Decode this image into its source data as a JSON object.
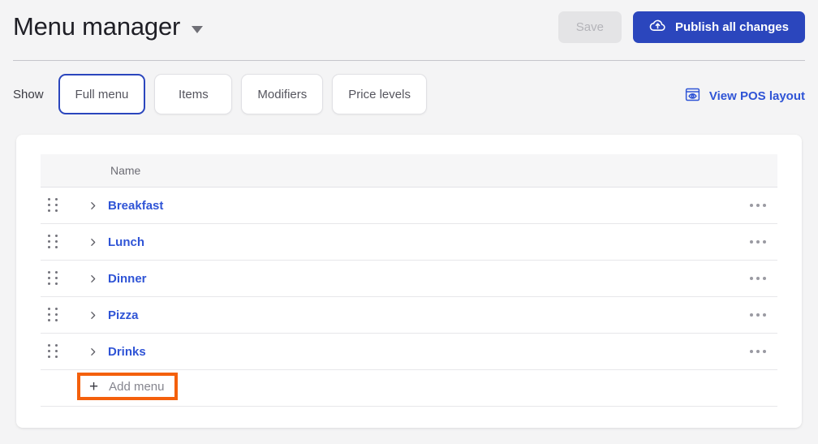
{
  "header": {
    "title": "Menu manager",
    "title_caret_icon": "chevron-down-icon",
    "save_label": "Save",
    "publish_label": "Publish all changes",
    "publish_icon": "cloud-upload-icon",
    "accent_blue": "#2b46bd"
  },
  "filter_bar": {
    "show_label": "Show",
    "tabs": [
      {
        "label": "Full menu",
        "selected": true
      },
      {
        "label": "Items",
        "selected": false
      },
      {
        "label": "Modifiers",
        "selected": false
      },
      {
        "label": "Price levels",
        "selected": false
      }
    ],
    "pos_link_label": "View POS layout",
    "pos_link_icon": "eye-window-icon",
    "link_color": "#2f54d6"
  },
  "table": {
    "columns": [
      "Name"
    ],
    "rows": [
      {
        "name": "Breakfast",
        "drag_icon": "drag-handle-icon",
        "expand_icon": "chevron-right-icon",
        "more_icon": "ellipsis-icon"
      },
      {
        "name": "Lunch",
        "drag_icon": "drag-handle-icon",
        "expand_icon": "chevron-right-icon",
        "more_icon": "ellipsis-icon"
      },
      {
        "name": "Dinner",
        "drag_icon": "drag-handle-icon",
        "expand_icon": "chevron-right-icon",
        "more_icon": "ellipsis-icon"
      },
      {
        "name": "Pizza",
        "drag_icon": "drag-handle-icon",
        "expand_icon": "chevron-right-icon",
        "more_icon": "ellipsis-icon"
      },
      {
        "name": "Drinks",
        "drag_icon": "drag-handle-icon",
        "expand_icon": "chevron-right-icon",
        "more_icon": "ellipsis-icon"
      }
    ],
    "add_row": {
      "plus": "+",
      "label": "Add menu",
      "highlight_color": "#f4600c"
    }
  }
}
